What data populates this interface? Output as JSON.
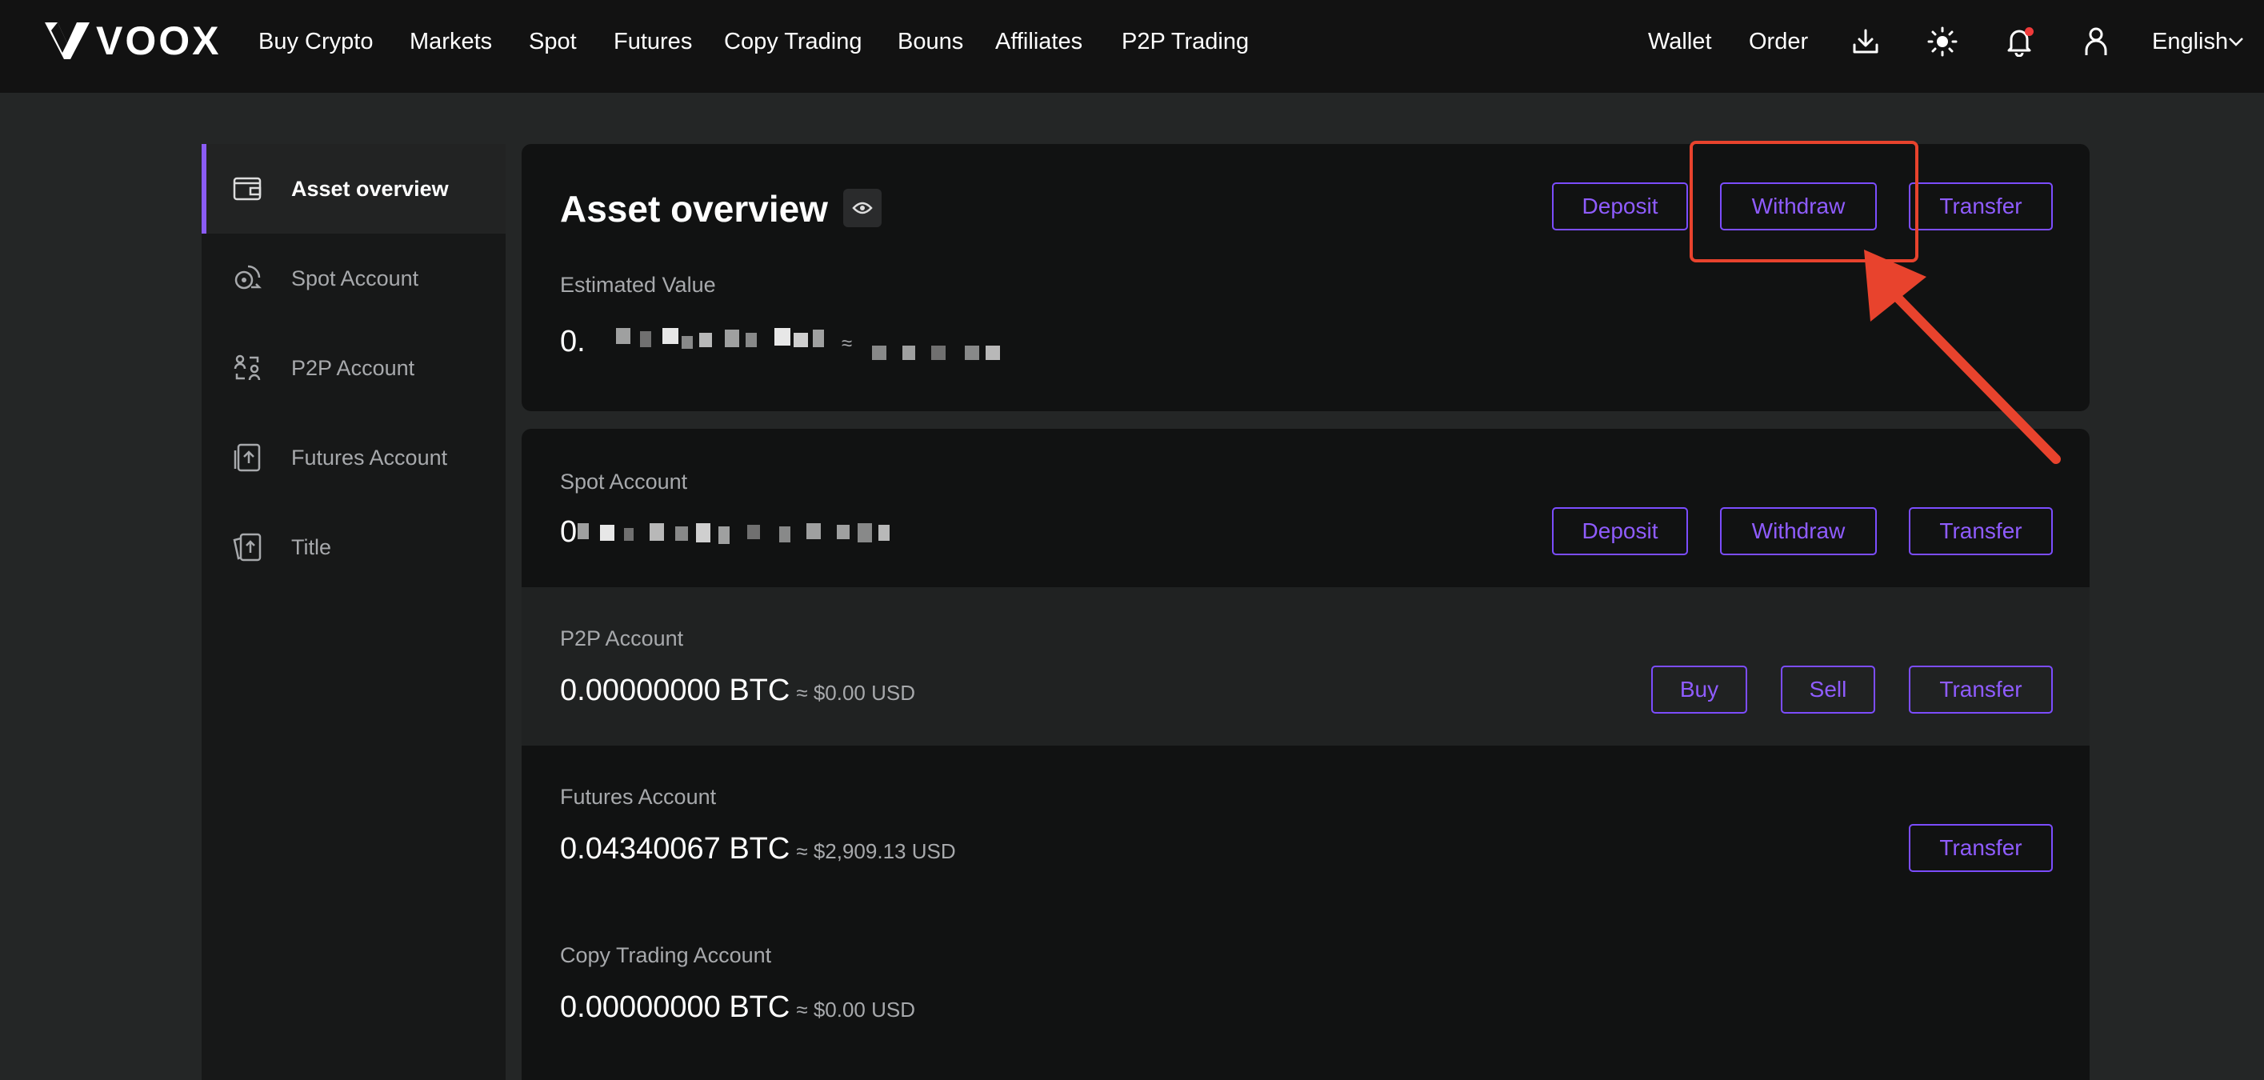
{
  "brand": {
    "name": "VOOX"
  },
  "nav": {
    "items": [
      "Buy Crypto",
      "Markets",
      "Spot",
      "Futures",
      "Copy Trading",
      "Bouns",
      "Affiliates",
      "P2P Trading"
    ],
    "right_items": {
      "wallet": "Wallet",
      "order": "Order",
      "language": "English"
    },
    "icons": [
      "download-icon",
      "theme-sun-icon",
      "bell-icon",
      "user-icon",
      "chevron-down-icon"
    ]
  },
  "sidebar": {
    "items": [
      {
        "label": "Asset overview",
        "icon": "wallet-icon",
        "active": true
      },
      {
        "label": "Spot Account",
        "icon": "spot-coins-icon",
        "active": false
      },
      {
        "label": "P2P Account",
        "icon": "p2p-exchange-icon",
        "active": false
      },
      {
        "label": "Futures Account",
        "icon": "futures-icon",
        "active": false
      },
      {
        "label": "Title",
        "icon": "cards-icon",
        "active": false
      }
    ]
  },
  "overview": {
    "title": "Asset overview",
    "estimated_label": "Estimated Value",
    "estimated_amount_visible": "0.",
    "approx_symbol": "≈",
    "buttons": {
      "deposit": "Deposit",
      "withdraw": "Withdraw",
      "transfer": "Transfer"
    }
  },
  "spot": {
    "label": "Spot Account",
    "amount_visible": "0",
    "buttons": {
      "deposit": "Deposit",
      "withdraw": "Withdraw",
      "transfer": "Transfer"
    }
  },
  "p2p": {
    "label": "P2P Account",
    "amount": "0.00000000 BTC",
    "approx": "≈ $0.00 USD",
    "buttons": {
      "buy": "Buy",
      "sell": "Sell",
      "transfer": "Transfer"
    }
  },
  "futures": {
    "label": "Futures Account",
    "amount": "0.04340067 BTC",
    "approx": "≈ $2,909.13 USD",
    "buttons": {
      "transfer": "Transfer"
    }
  },
  "copy_trading": {
    "label": "Copy Trading Account",
    "amount": "0.00000000 BTC",
    "approx": "≈ $0.00 USD"
  },
  "colors": {
    "accent": "#8b5cf6",
    "highlight": "#e8432d",
    "background": "#242626"
  }
}
